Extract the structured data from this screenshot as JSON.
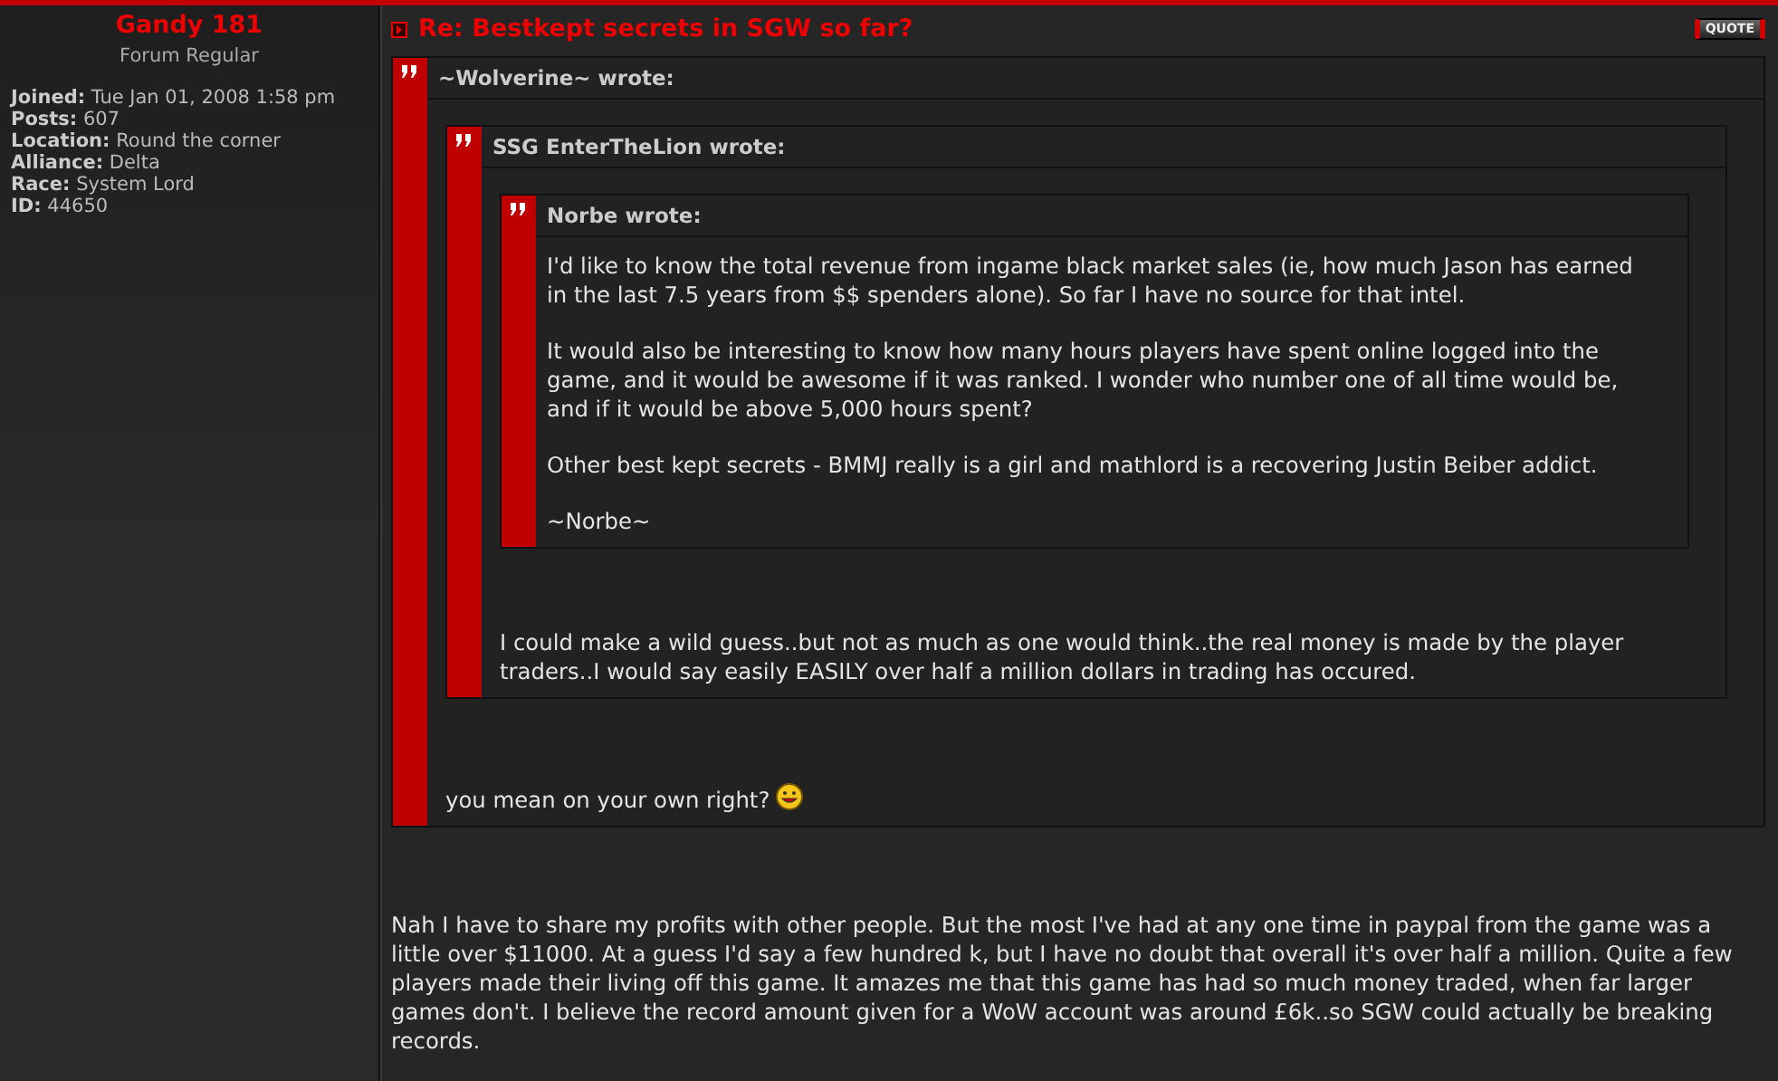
{
  "author": {
    "name": "Gandy 181",
    "rank": "Forum Regular",
    "details": [
      {
        "label": "Joined:",
        "value": "Tue Jan 01, 2008 1:58 pm"
      },
      {
        "label": "Posts:",
        "value": "607"
      },
      {
        "label": "Location:",
        "value": "Round the corner"
      },
      {
        "label": "Alliance:",
        "value": "Delta"
      },
      {
        "label": "Race:",
        "value": "System Lord"
      },
      {
        "label": "ID:",
        "value": "44650"
      }
    ]
  },
  "post": {
    "title": "Re: Bestkept secrets in SGW so far?",
    "quote_button": "QUOTE",
    "quote": {
      "header": "~Wolverine~ wrote:",
      "quote": {
        "header": "SSG EnterTheLion wrote:",
        "quote": {
          "header": "Norbe wrote:",
          "paragraphs": [
            "I'd like to know the total revenue from ingame black market sales (ie, how much Jason has earned in the last 7.5 years from $$ spenders alone). So far I have no source for that intel.",
            "It would also be interesting to know how many hours players have spent online logged into the game, and it would be awesome if it was ranked. I wonder who number one of all time would be, and if it would be above 5,000 hours spent?",
            "Other best kept secrets - BMMJ really is a girl and mathlord is a recovering Justin Beiber addict.",
            "~Norbe~"
          ]
        },
        "paragraphs": [
          "I could make a wild guess..but not as much as one would think..the real money is made by the player traders..I would say easily EASILY over half a million dollars in trading has occured."
        ]
      },
      "paragraphs": [
        "you mean on your own right?"
      ],
      "smiley": true
    },
    "body": "Nah I have to share my profits with other people. But the most I've had at any one time in paypal from the game was a little over $11000. At a guess I'd say a few hundred k, but I have no doubt that overall it's over half a million. Quite a few players made their living off this game. It amazes me that this game has had so much money traded, when far larger games don't. I believe the record amount given for a WoW account was around £6k..so SGW could actually be breaking records."
  }
}
